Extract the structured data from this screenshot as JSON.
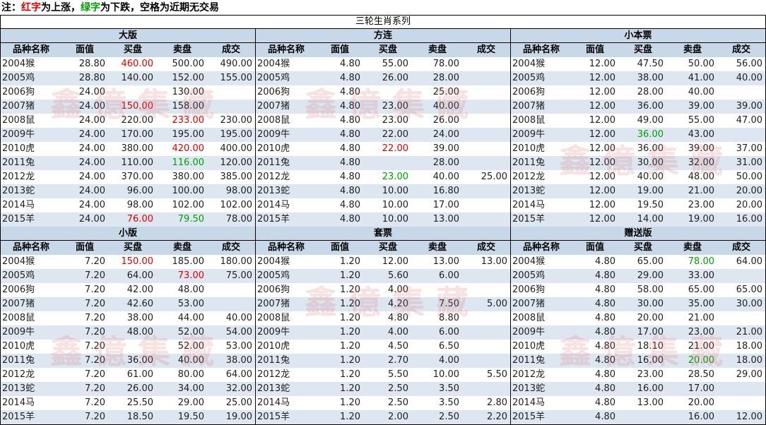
{
  "note": {
    "prefix": "注：",
    "red_word": "红字",
    "red_rest": "为上涨，",
    "green_word": "绿字",
    "green_rest": "为下跌，空格为近期无交易"
  },
  "main_title": "三轮生肖系列",
  "colors": {
    "red": "#e00000",
    "green": "#00a000",
    "header_bg": "#c9d8e8",
    "stripe": "#dde6f1"
  },
  "sections": [
    {
      "title": "大版",
      "headers": [
        "品种名称",
        "面值",
        "买盘",
        "卖盘",
        "成交"
      ],
      "rows": [
        [
          "2004猴",
          "28.80",
          "460.00",
          "500.00",
          "490.00"
        ],
        [
          "2005鸡",
          "28.80",
          "140.00",
          "152.00",
          "155.00"
        ],
        [
          "2006狗",
          "24.00",
          "",
          "130.00",
          ""
        ],
        [
          "2007猪",
          "24.00",
          "150.00",
          "158.00",
          ""
        ],
        [
          "2008鼠",
          "24.00",
          "220.00",
          "233.00",
          "230.00"
        ],
        [
          "2009牛",
          "24.00",
          "170.00",
          "195.00",
          "195.00"
        ],
        [
          "2010虎",
          "24.00",
          "380.00",
          "420.00",
          "400.00"
        ],
        [
          "2011兔",
          "24.00",
          "110.00",
          "116.00",
          "120.00"
        ],
        [
          "2012龙",
          "24.00",
          "370.00",
          "380.00",
          "385.00"
        ],
        [
          "2013蛇",
          "24.00",
          "96.00",
          "100.00",
          "98.00"
        ],
        [
          "2014马",
          "24.00",
          "98.00",
          "102.00",
          "102.00"
        ],
        [
          "2015羊",
          "24.00",
          "76.00",
          "79.50",
          "78.00"
        ]
      ],
      "colors": [
        [
          "",
          "",
          "red",
          "",
          ""
        ],
        [
          "",
          "",
          "",
          "",
          ""
        ],
        [
          "",
          "",
          "",
          "",
          ""
        ],
        [
          "",
          "",
          "red",
          "",
          ""
        ],
        [
          "",
          "",
          "",
          "red",
          ""
        ],
        [
          "",
          "",
          "",
          "",
          ""
        ],
        [
          "",
          "",
          "",
          "red",
          ""
        ],
        [
          "",
          "",
          "",
          "green",
          ""
        ],
        [
          "",
          "",
          "",
          "",
          ""
        ],
        [
          "",
          "",
          "",
          "",
          ""
        ],
        [
          "",
          "",
          "",
          "",
          ""
        ],
        [
          "",
          "",
          "red",
          "green",
          ""
        ]
      ]
    },
    {
      "title": "方连",
      "headers": [
        "品种名称",
        "面值",
        "买盘",
        "卖盘",
        "成交"
      ],
      "rows": [
        [
          "2004猴",
          "4.80",
          "55.00",
          "78.00",
          ""
        ],
        [
          "2005鸡",
          "4.80",
          "26.00",
          "28.00",
          ""
        ],
        [
          "2006狗",
          "4.80",
          "",
          "25.00",
          ""
        ],
        [
          "2007猪",
          "4.80",
          "23.00",
          "40.00",
          ""
        ],
        [
          "2008鼠",
          "4.80",
          "23.00",
          "26.00",
          ""
        ],
        [
          "2009牛",
          "4.80",
          "22.00",
          "24.00",
          ""
        ],
        [
          "2010虎",
          "4.80",
          "22.00",
          "39.00",
          ""
        ],
        [
          "2011兔",
          "4.80",
          "",
          "28.00",
          ""
        ],
        [
          "2012龙",
          "4.80",
          "23.00",
          "40.00",
          "25.00"
        ],
        [
          "2013蛇",
          "4.80",
          "10.00",
          "16.80",
          ""
        ],
        [
          "2014马",
          "4.80",
          "10.00",
          "17.00",
          ""
        ],
        [
          "2015羊",
          "4.80",
          "10.00",
          "13.00",
          ""
        ]
      ],
      "colors": [
        [
          "",
          "",
          "",
          "",
          ""
        ],
        [
          "",
          "",
          "",
          "",
          ""
        ],
        [
          "",
          "",
          "",
          "",
          ""
        ],
        [
          "",
          "",
          "",
          "",
          ""
        ],
        [
          "",
          "",
          "",
          "",
          ""
        ],
        [
          "",
          "",
          "",
          "",
          ""
        ],
        [
          "",
          "",
          "red",
          "",
          ""
        ],
        [
          "",
          "",
          "",
          "",
          ""
        ],
        [
          "",
          "",
          "green",
          "",
          ""
        ],
        [
          "",
          "",
          "",
          "",
          ""
        ],
        [
          "",
          "",
          "",
          "",
          ""
        ],
        [
          "",
          "",
          "",
          "",
          ""
        ]
      ]
    },
    {
      "title": "小本票",
      "headers": [
        "品种名称",
        "面值",
        "买盘",
        "卖盘",
        "成交"
      ],
      "rows": [
        [
          "2004猴",
          "12.00",
          "47.50",
          "50.00",
          "56.00"
        ],
        [
          "2005鸡",
          "12.00",
          "38.00",
          "41.00",
          "40.00"
        ],
        [
          "2006狗",
          "12.00",
          "28.00",
          "40.00",
          ""
        ],
        [
          "2007猪",
          "12.00",
          "36.00",
          "39.00",
          "39.00"
        ],
        [
          "2008鼠",
          "12.00",
          "49.00",
          "55.00",
          "47.00"
        ],
        [
          "2009牛",
          "12.00",
          "36.00",
          "43.00",
          ""
        ],
        [
          "2010虎",
          "12.00",
          "36.00",
          "39.00",
          "37.00"
        ],
        [
          "2011兔",
          "12.00",
          "30.00",
          "32.00",
          "31.00"
        ],
        [
          "2012龙",
          "12.00",
          "40.00",
          "48.00",
          "50.00"
        ],
        [
          "2013蛇",
          "12.00",
          "19.00",
          "21.00",
          "20.00"
        ],
        [
          "2014马",
          "12.00",
          "19.50",
          "23.00",
          "20.00"
        ],
        [
          "2015羊",
          "12.00",
          "14.00",
          "19.00",
          "16.00"
        ]
      ],
      "colors": [
        [
          "",
          "",
          "",
          "",
          ""
        ],
        [
          "",
          "",
          "",
          "",
          ""
        ],
        [
          "",
          "",
          "",
          "",
          ""
        ],
        [
          "",
          "",
          "",
          "",
          ""
        ],
        [
          "",
          "",
          "",
          "",
          ""
        ],
        [
          "",
          "",
          "green",
          "",
          ""
        ],
        [
          "",
          "",
          "",
          "",
          ""
        ],
        [
          "",
          "",
          "",
          "",
          ""
        ],
        [
          "",
          "",
          "",
          "",
          ""
        ],
        [
          "",
          "",
          "",
          "",
          ""
        ],
        [
          "",
          "",
          "",
          "",
          ""
        ],
        [
          "",
          "",
          "",
          "",
          ""
        ]
      ]
    },
    {
      "title": "小版",
      "headers": [
        "品种名称",
        "面值",
        "买盘",
        "卖盘",
        "成交"
      ],
      "rows": [
        [
          "2004猴",
          "7.20",
          "150.00",
          "185.00",
          "180.00"
        ],
        [
          "2005鸡",
          "7.20",
          "64.00",
          "73.00",
          "75.00"
        ],
        [
          "2006狗",
          "7.20",
          "42.00",
          "48.00",
          ""
        ],
        [
          "2007猪",
          "7.20",
          "42.60",
          "53.00",
          ""
        ],
        [
          "2008鼠",
          "7.20",
          "38.00",
          "44.00",
          "40.00"
        ],
        [
          "2009牛",
          "7.20",
          "48.00",
          "52.00",
          "54.00"
        ],
        [
          "2010虎",
          "7.20",
          "",
          "52.00",
          "53.00"
        ],
        [
          "2011兔",
          "7.20",
          "36.00",
          "40.00",
          "38.00"
        ],
        [
          "2012龙",
          "7.20",
          "61.00",
          "80.00",
          "64.00"
        ],
        [
          "2013蛇",
          "7.20",
          "26.00",
          "34.00",
          "32.00"
        ],
        [
          "2014马",
          "7.20",
          "25.50",
          "29.00",
          "25.00"
        ],
        [
          "2015羊",
          "7.20",
          "18.50",
          "19.50",
          "19.00"
        ]
      ],
      "colors": [
        [
          "",
          "",
          "red",
          "",
          ""
        ],
        [
          "",
          "",
          "",
          "red",
          ""
        ],
        [
          "",
          "",
          "",
          "",
          ""
        ],
        [
          "",
          "",
          "",
          "",
          ""
        ],
        [
          "",
          "",
          "",
          "",
          ""
        ],
        [
          "",
          "",
          "",
          "",
          ""
        ],
        [
          "",
          "",
          "",
          "",
          ""
        ],
        [
          "",
          "",
          "",
          "",
          ""
        ],
        [
          "",
          "",
          "",
          "",
          ""
        ],
        [
          "",
          "",
          "",
          "",
          ""
        ],
        [
          "",
          "",
          "",
          "",
          ""
        ],
        [
          "",
          "",
          "",
          "",
          ""
        ]
      ]
    },
    {
      "title": "套票",
      "headers": [
        "品种名称",
        "面值",
        "买盘",
        "卖盘",
        "成交"
      ],
      "rows": [
        [
          "2004猴",
          "1.20",
          "12.00",
          "13.00",
          "13.00"
        ],
        [
          "2005鸡",
          "1.20",
          "5.60",
          "6.00",
          ""
        ],
        [
          "2006狗",
          "1.20",
          "4.00",
          "",
          ""
        ],
        [
          "2007猪",
          "1.20",
          "4.20",
          "7.50",
          "5.00"
        ],
        [
          "2008鼠",
          "1.20",
          "4.80",
          "8.80",
          ""
        ],
        [
          "2009牛",
          "1.20",
          "4.00",
          "6.00",
          ""
        ],
        [
          "2010虎",
          "1.20",
          "4.50",
          "6.50",
          ""
        ],
        [
          "2011兔",
          "1.20",
          "2.70",
          "4.00",
          ""
        ],
        [
          "2012龙",
          "1.20",
          "5.50",
          "10.00",
          "5.50"
        ],
        [
          "2013蛇",
          "1.20",
          "2.50",
          "3.50",
          ""
        ],
        [
          "2014马",
          "1.20",
          "2.50",
          "3.50",
          "2.80"
        ],
        [
          "2015羊",
          "1.20",
          "2.00",
          "2.50",
          "2.20"
        ]
      ],
      "colors": [
        [
          "",
          "",
          "",
          "",
          ""
        ],
        [
          "",
          "",
          "",
          "",
          ""
        ],
        [
          "",
          "",
          "",
          "",
          ""
        ],
        [
          "",
          "",
          "",
          "",
          ""
        ],
        [
          "",
          "",
          "",
          "",
          ""
        ],
        [
          "",
          "",
          "",
          "",
          ""
        ],
        [
          "",
          "",
          "",
          "",
          ""
        ],
        [
          "",
          "",
          "",
          "",
          ""
        ],
        [
          "",
          "",
          "",
          "",
          ""
        ],
        [
          "",
          "",
          "",
          "",
          ""
        ],
        [
          "",
          "",
          "",
          "",
          ""
        ],
        [
          "",
          "",
          "",
          "",
          ""
        ]
      ]
    },
    {
      "title": "赠送版",
      "headers": [
        "品种名称",
        "面值",
        "买盘",
        "卖盘",
        "成交"
      ],
      "rows": [
        [
          "2004猴",
          "4.80",
          "65.00",
          "78.00",
          "64.00"
        ],
        [
          "2005鸡",
          "4.80",
          "29.00",
          "33.00",
          ""
        ],
        [
          "2006狗",
          "4.80",
          "58.00",
          "65.00",
          "65.00"
        ],
        [
          "2007猪",
          "4.80",
          "30.00",
          "35.00",
          "30.00"
        ],
        [
          "2008鼠",
          "4.80",
          "20.00",
          "21.00",
          ""
        ],
        [
          "2009牛",
          "4.80",
          "17.00",
          "23.00",
          "21.00"
        ],
        [
          "2010虎",
          "4.80",
          "18.10",
          "21.00",
          "18.00"
        ],
        [
          "2011兔",
          "4.80",
          "16.00",
          "20.00",
          "18.00"
        ],
        [
          "2012龙",
          "4.80",
          "23.00",
          "28.50",
          "29.00"
        ],
        [
          "2013蛇",
          "4.80",
          "16.00",
          "17.00",
          ""
        ],
        [
          "2014马",
          "4.80",
          "13.00",
          "20.00",
          ""
        ],
        [
          "2015羊",
          "4.80",
          "",
          "16.00",
          "12.00"
        ]
      ],
      "colors": [
        [
          "",
          "",
          "",
          "green",
          ""
        ],
        [
          "",
          "",
          "",
          "",
          ""
        ],
        [
          "",
          "",
          "",
          "",
          ""
        ],
        [
          "",
          "",
          "",
          "",
          ""
        ],
        [
          "",
          "",
          "",
          "",
          ""
        ],
        [
          "",
          "",
          "",
          "",
          ""
        ],
        [
          "",
          "",
          "",
          "",
          ""
        ],
        [
          "",
          "",
          "",
          "green",
          ""
        ],
        [
          "",
          "",
          "",
          "",
          ""
        ],
        [
          "",
          "",
          "",
          "",
          ""
        ],
        [
          "",
          "",
          "",
          "",
          ""
        ],
        [
          "",
          "",
          "",
          "",
          ""
        ]
      ]
    }
  ]
}
